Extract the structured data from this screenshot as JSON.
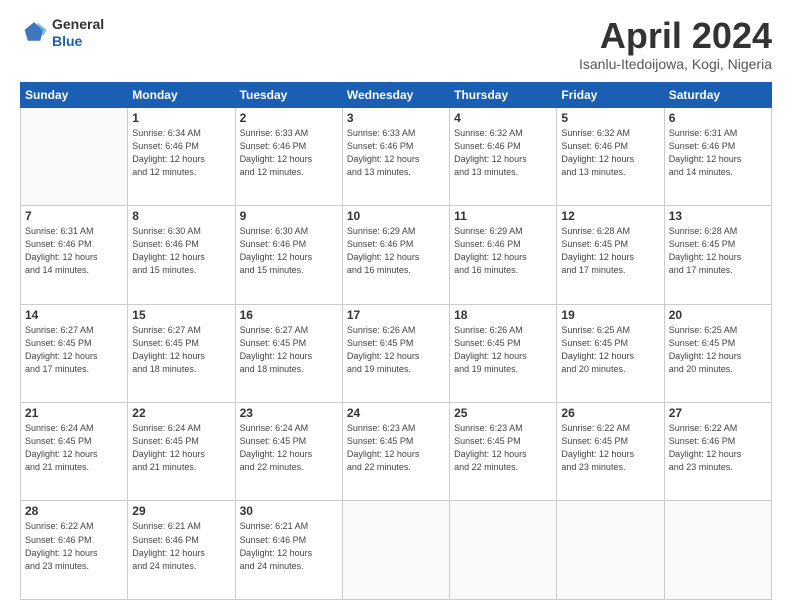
{
  "header": {
    "logo": {
      "general": "General",
      "blue": "Blue"
    },
    "title": "April 2024",
    "location": "Isanlu-Itedoijowa, Kogi, Nigeria"
  },
  "calendar": {
    "weekdays": [
      "Sunday",
      "Monday",
      "Tuesday",
      "Wednesday",
      "Thursday",
      "Friday",
      "Saturday"
    ],
    "weeks": [
      [
        {
          "day": "",
          "info": ""
        },
        {
          "day": "1",
          "info": "Sunrise: 6:34 AM\nSunset: 6:46 PM\nDaylight: 12 hours\nand 12 minutes."
        },
        {
          "day": "2",
          "info": "Sunrise: 6:33 AM\nSunset: 6:46 PM\nDaylight: 12 hours\nand 12 minutes."
        },
        {
          "day": "3",
          "info": "Sunrise: 6:33 AM\nSunset: 6:46 PM\nDaylight: 12 hours\nand 13 minutes."
        },
        {
          "day": "4",
          "info": "Sunrise: 6:32 AM\nSunset: 6:46 PM\nDaylight: 12 hours\nand 13 minutes."
        },
        {
          "day": "5",
          "info": "Sunrise: 6:32 AM\nSunset: 6:46 PM\nDaylight: 12 hours\nand 13 minutes."
        },
        {
          "day": "6",
          "info": "Sunrise: 6:31 AM\nSunset: 6:46 PM\nDaylight: 12 hours\nand 14 minutes."
        }
      ],
      [
        {
          "day": "7",
          "info": "Sunrise: 6:31 AM\nSunset: 6:46 PM\nDaylight: 12 hours\nand 14 minutes."
        },
        {
          "day": "8",
          "info": "Sunrise: 6:30 AM\nSunset: 6:46 PM\nDaylight: 12 hours\nand 15 minutes."
        },
        {
          "day": "9",
          "info": "Sunrise: 6:30 AM\nSunset: 6:46 PM\nDaylight: 12 hours\nand 15 minutes."
        },
        {
          "day": "10",
          "info": "Sunrise: 6:29 AM\nSunset: 6:46 PM\nDaylight: 12 hours\nand 16 minutes."
        },
        {
          "day": "11",
          "info": "Sunrise: 6:29 AM\nSunset: 6:46 PM\nDaylight: 12 hours\nand 16 minutes."
        },
        {
          "day": "12",
          "info": "Sunrise: 6:28 AM\nSunset: 6:45 PM\nDaylight: 12 hours\nand 17 minutes."
        },
        {
          "day": "13",
          "info": "Sunrise: 6:28 AM\nSunset: 6:45 PM\nDaylight: 12 hours\nand 17 minutes."
        }
      ],
      [
        {
          "day": "14",
          "info": "Sunrise: 6:27 AM\nSunset: 6:45 PM\nDaylight: 12 hours\nand 17 minutes."
        },
        {
          "day": "15",
          "info": "Sunrise: 6:27 AM\nSunset: 6:45 PM\nDaylight: 12 hours\nand 18 minutes."
        },
        {
          "day": "16",
          "info": "Sunrise: 6:27 AM\nSunset: 6:45 PM\nDaylight: 12 hours\nand 18 minutes."
        },
        {
          "day": "17",
          "info": "Sunrise: 6:26 AM\nSunset: 6:45 PM\nDaylight: 12 hours\nand 19 minutes."
        },
        {
          "day": "18",
          "info": "Sunrise: 6:26 AM\nSunset: 6:45 PM\nDaylight: 12 hours\nand 19 minutes."
        },
        {
          "day": "19",
          "info": "Sunrise: 6:25 AM\nSunset: 6:45 PM\nDaylight: 12 hours\nand 20 minutes."
        },
        {
          "day": "20",
          "info": "Sunrise: 6:25 AM\nSunset: 6:45 PM\nDaylight: 12 hours\nand 20 minutes."
        }
      ],
      [
        {
          "day": "21",
          "info": "Sunrise: 6:24 AM\nSunset: 6:45 PM\nDaylight: 12 hours\nand 21 minutes."
        },
        {
          "day": "22",
          "info": "Sunrise: 6:24 AM\nSunset: 6:45 PM\nDaylight: 12 hours\nand 21 minutes."
        },
        {
          "day": "23",
          "info": "Sunrise: 6:24 AM\nSunset: 6:45 PM\nDaylight: 12 hours\nand 22 minutes."
        },
        {
          "day": "24",
          "info": "Sunrise: 6:23 AM\nSunset: 6:45 PM\nDaylight: 12 hours\nand 22 minutes."
        },
        {
          "day": "25",
          "info": "Sunrise: 6:23 AM\nSunset: 6:45 PM\nDaylight: 12 hours\nand 22 minutes."
        },
        {
          "day": "26",
          "info": "Sunrise: 6:22 AM\nSunset: 6:45 PM\nDaylight: 12 hours\nand 23 minutes."
        },
        {
          "day": "27",
          "info": "Sunrise: 6:22 AM\nSunset: 6:46 PM\nDaylight: 12 hours\nand 23 minutes."
        }
      ],
      [
        {
          "day": "28",
          "info": "Sunrise: 6:22 AM\nSunset: 6:46 PM\nDaylight: 12 hours\nand 23 minutes."
        },
        {
          "day": "29",
          "info": "Sunrise: 6:21 AM\nSunset: 6:46 PM\nDaylight: 12 hours\nand 24 minutes."
        },
        {
          "day": "30",
          "info": "Sunrise: 6:21 AM\nSunset: 6:46 PM\nDaylight: 12 hours\nand 24 minutes."
        },
        {
          "day": "",
          "info": ""
        },
        {
          "day": "",
          "info": ""
        },
        {
          "day": "",
          "info": ""
        },
        {
          "day": "",
          "info": ""
        }
      ]
    ]
  }
}
